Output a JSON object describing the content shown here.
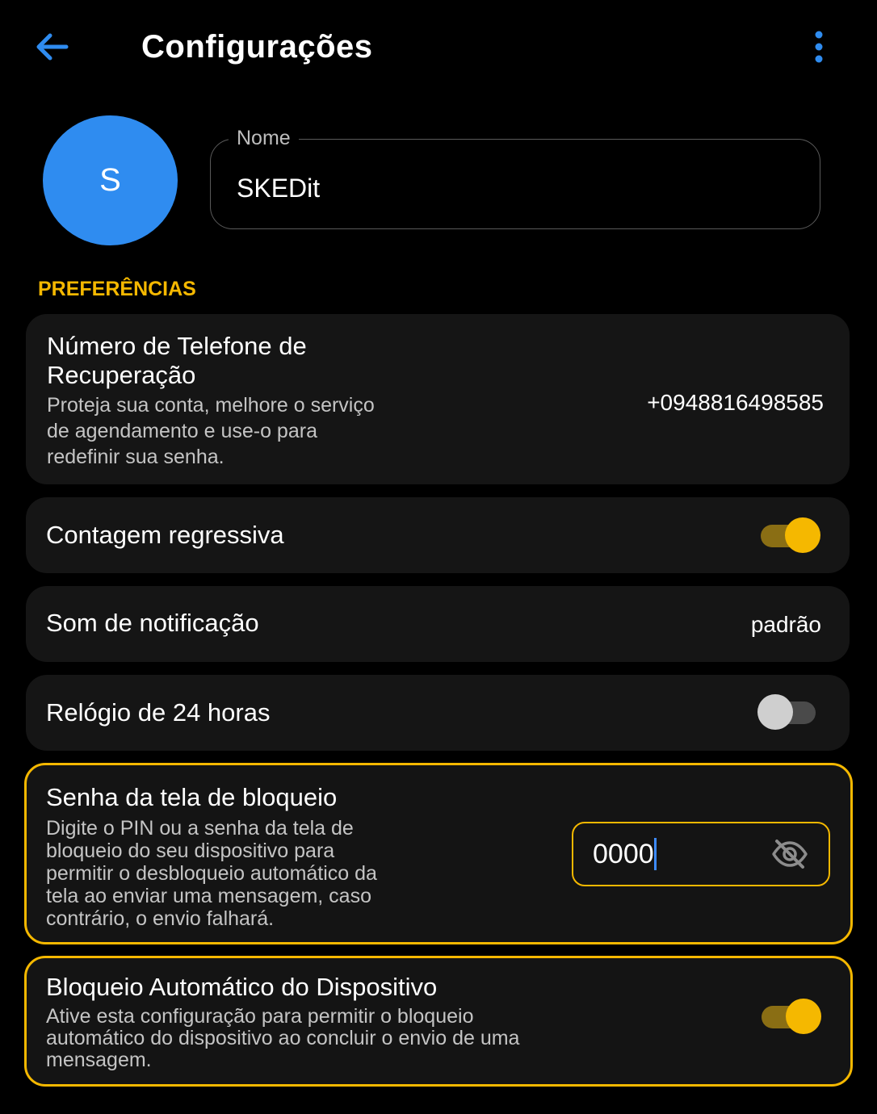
{
  "header": {
    "title": "Configurações",
    "back_icon": "arrow-left-icon",
    "more_icon": "more-vertical-icon",
    "accent_color": "#2f8cf0"
  },
  "profile": {
    "avatar_letter": "S",
    "avatar_color": "#2f8cf0",
    "name_label": "Nome",
    "name_value": "SKEDit"
  },
  "preferences": {
    "section_label": "PREFERÊNCIAS",
    "section_color": "#f5b800",
    "recovery_phone": {
      "title_line1": "Número de Telefone de",
      "title_line2": "Recuperação",
      "desc_line1": "Proteja sua conta, melhore o serviço",
      "desc_line2": "de agendamento e use-o para",
      "desc_line3": "redefinir sua senha.",
      "value": "+0948816498585"
    },
    "countdown": {
      "title": "Contagem regressiva",
      "enabled": true
    },
    "notification_sound": {
      "title": "Som de notificação",
      "value": "padrão"
    },
    "clock_24h": {
      "title": "Relógio de 24 horas",
      "enabled": false
    },
    "lock_screen_password": {
      "title": "Senha da tela de bloqueio",
      "desc_line1": "Digite o PIN ou a senha da tela de",
      "desc_line2": "bloqueio do seu dispositivo para",
      "desc_line3": "permitir o desbloqueio automático da",
      "desc_line4": "tela ao enviar uma mensagem, caso",
      "desc_line5": "contrário, o envio falhará.",
      "pin_value": "0000",
      "visibility_icon": "eye-off-icon"
    },
    "auto_lock": {
      "title": "Bloqueio Automático do Dispositivo",
      "desc_line1": "Ative esta configuração para permitir o bloqueio",
      "desc_line2": "automático do dispositivo ao concluir o envio de uma",
      "desc_line3": "mensagem.",
      "enabled": true
    }
  }
}
